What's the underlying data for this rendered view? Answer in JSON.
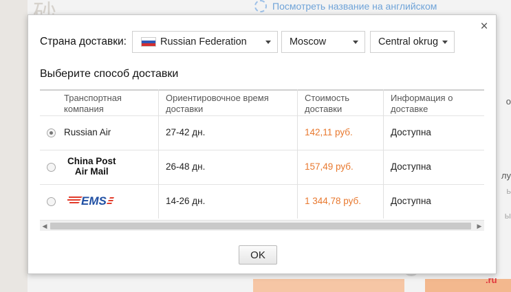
{
  "background": {
    "top_link": "Посмотреть название на английском",
    "right_fragments": [
      "о",
      "лу",
      "ь",
      "ы"
    ],
    "watermark_suffix": ".ru"
  },
  "modal": {
    "country_label": "Страна доставки:",
    "country": "Russian Federation",
    "city": "Moscow",
    "region": "Central okrug",
    "subtitle": "Выберите способ доставки",
    "columns": [
      "Транспортная компания",
      "Ориентировочное время доставки",
      "Стоимость доставки",
      "Информация о доставке"
    ],
    "rows": [
      {
        "carrier": "Russian Air",
        "time": "27-42 дн.",
        "price": "142,11 руб.",
        "info": "Доступна",
        "selected": true
      },
      {
        "carrier": "China Post Air Mail",
        "carrier_line1": "China Post",
        "carrier_line2": "Air Mail",
        "time": "26-48 дн.",
        "price": "157,49 руб.",
        "info": "Доступна",
        "selected": false
      },
      {
        "carrier": "EMS",
        "time": "14-26 дн.",
        "price": "1 344,78 руб.",
        "info": "Доступна",
        "selected": false
      }
    ],
    "ok_label": "OK",
    "close_symbol": "×"
  },
  "colors": {
    "price": "#e8782e",
    "link": "#6fa3d8",
    "ems_blue": "#1f4fa3",
    "ems_red": "#e23b2a"
  }
}
